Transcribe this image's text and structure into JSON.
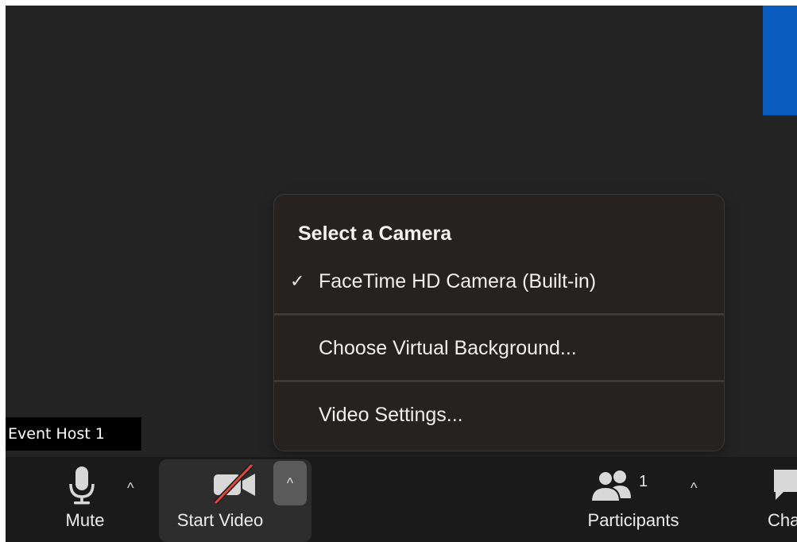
{
  "participant": {
    "name": "Event Host 1"
  },
  "camera_menu": {
    "heading": "Select a Camera",
    "items": [
      {
        "label": "FaceTime HD Camera (Built-in)",
        "checked": true
      },
      {
        "label": "Choose Virtual Background..."
      },
      {
        "label": "Video Settings..."
      }
    ],
    "check_glyph": "✓"
  },
  "toolbar": {
    "mute": {
      "label": "Mute",
      "icon": "microphone-icon"
    },
    "video": {
      "label": "Start Video",
      "icon": "video-off-icon"
    },
    "participants": {
      "label": "Participants",
      "count": "1",
      "icon": "participants-icon"
    },
    "chat": {
      "label": "Cha",
      "icon": "chat-icon"
    },
    "caret_glyph": "^"
  },
  "colors": {
    "stage": "#242424",
    "toolbar": "#1a1a1a",
    "menu": "#252220",
    "accent_blue": "#0a5cbf",
    "video_off_slash": "#e0463c"
  }
}
